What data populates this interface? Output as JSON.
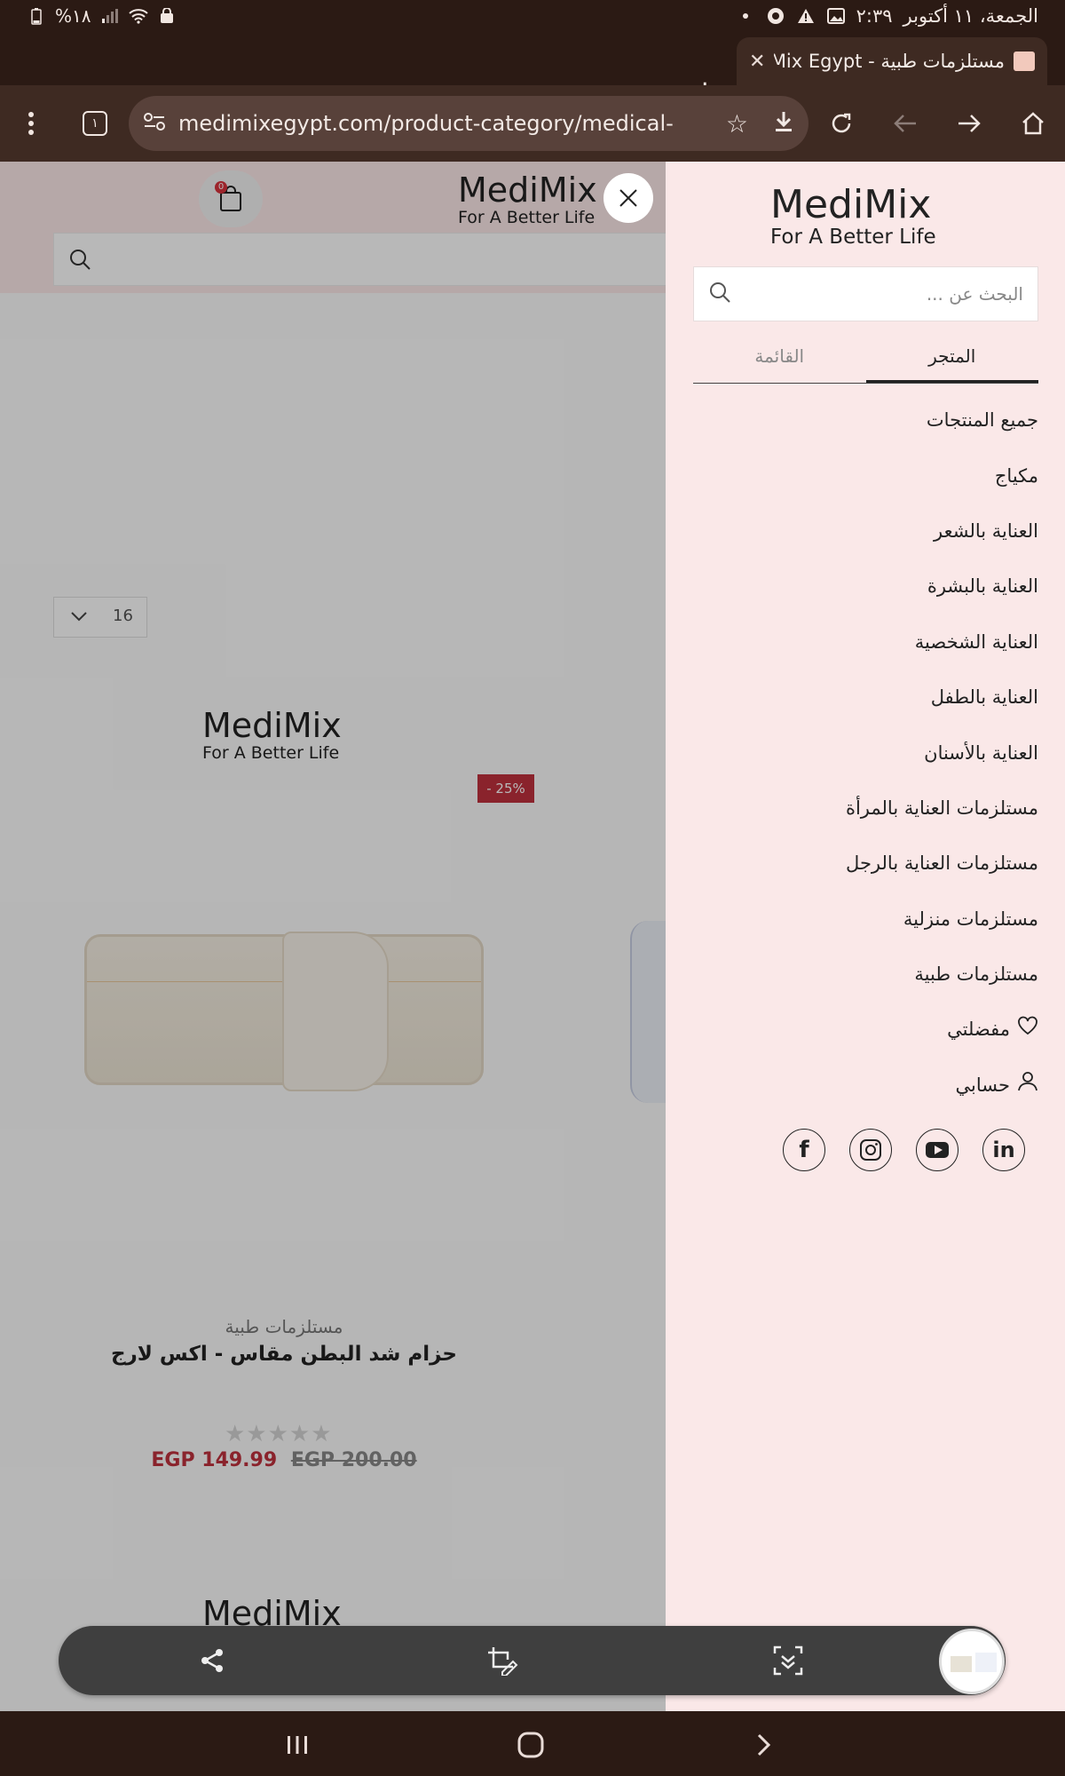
{
  "status_bar": {
    "date": "الجمعة، ١١ أكتوبر",
    "time": "٢:٣٩",
    "battery": "%١٨"
  },
  "tab": {
    "title": "مستلزمات طبية - MediMix Egypt"
  },
  "toolbar": {
    "url": "medimixegypt.com/product-category/medical-",
    "tab_count": "١"
  },
  "logo": {
    "brand": "MediMix",
    "tagline": "For A Better Life"
  },
  "page": {
    "per_page_value": "16",
    "cart_count": "0",
    "product": {
      "badge": "- 25%",
      "category": "مستلزمات طبية",
      "name": "حزام شد البطن مقاس - اكس لارج",
      "price_new": "EGP 149.99",
      "price_old": "EGP 200.00",
      "rating_stars": 5
    }
  },
  "drawer": {
    "search_placeholder": "البحث عن ...",
    "tabs": [
      "المتجر",
      "القائمة"
    ],
    "active_tab": 0,
    "menu_items": [
      "جميع المنتجات",
      "مكياج",
      "العناية بالشعر",
      "العناية بالبشرة",
      "العناية الشخصية",
      "العناية بالطفل",
      "العناية بالأسنان",
      "مستلزمات العناية بالمرأة",
      "مستلزمات العناية بالرجل",
      "مستلزمات منزلية",
      "مستلزمات طبية"
    ],
    "wishlist_label": "مفضلتي",
    "account_label": "حسابي",
    "socials": [
      "facebook-icon",
      "instagram-icon",
      "youtube-icon",
      "linkedin-icon"
    ]
  },
  "colors": {
    "drawer_bg": "#fae8e8",
    "header_bg": "#fde9e9",
    "browser_chrome": "#3e2a22",
    "sale_red": "#c0313d"
  }
}
